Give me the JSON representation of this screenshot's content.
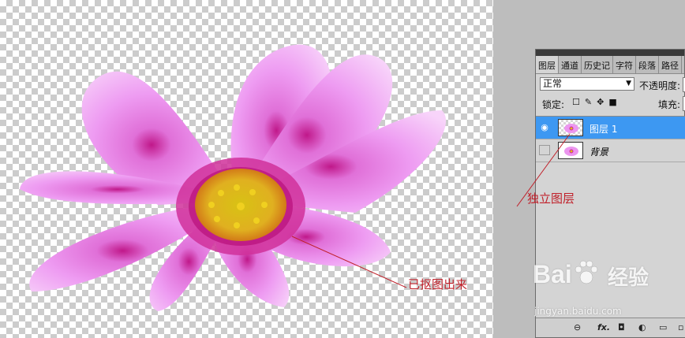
{
  "panel": {
    "tabs": [
      "图层",
      "通道",
      "历史记",
      "字符",
      "段落",
      "路径"
    ],
    "blend_mode": "正常",
    "opacity_label": "不透明度:",
    "lock_label": "锁定:",
    "fill_label": "填充:",
    "layers": [
      {
        "name": "图层 1",
        "visible": true,
        "selected": true
      },
      {
        "name": "背景",
        "visible": false,
        "selected": false
      }
    ],
    "bottom_icons": [
      "link-icon",
      "fx-icon",
      "mask-icon",
      "adjustment-icon",
      "group-icon",
      "new-layer-icon"
    ],
    "bottom_fx_label": "fx."
  },
  "annotations": {
    "layer_note": "独立图层",
    "flower_note": "已抠图出来",
    "color": "#c0202a"
  },
  "watermark": {
    "brand": "Bai",
    "brand_cn": "经验",
    "url": "jingyan.baidu.com"
  },
  "colors": {
    "selection": "#3d98f2",
    "petal": "#e59af0",
    "center": "#e0c010"
  }
}
